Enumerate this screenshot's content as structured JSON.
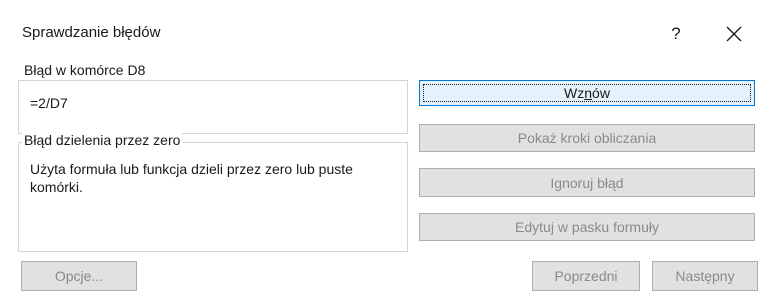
{
  "dialog": {
    "title": "Sprawdzanie błędów",
    "help_label": "?"
  },
  "error": {
    "location_label": "Błąd w komórce D8",
    "formula": "=2/D7",
    "type_label": "Błąd dzielenia przez zero",
    "description": "Użyta formuła lub funkcja dzieli przez zero lub puste komórki."
  },
  "buttons": {
    "resume_before": "Wz",
    "resume_mnemonic": "n",
    "resume_after": "ów",
    "show_steps": "Pokaż kroki obliczania",
    "ignore": "Ignoruj błąd",
    "edit_formula_bar": "Edytuj w pasku formuły",
    "options": "Opcje...",
    "previous": "Poprzedni",
    "next": "Następny"
  },
  "icons": {
    "close": "close-icon"
  },
  "colors": {
    "accent": "#0078d7",
    "button_face": "#e1e1e1",
    "disabled_text": "#8a8a8a",
    "group_border": "#d5d5d5"
  }
}
